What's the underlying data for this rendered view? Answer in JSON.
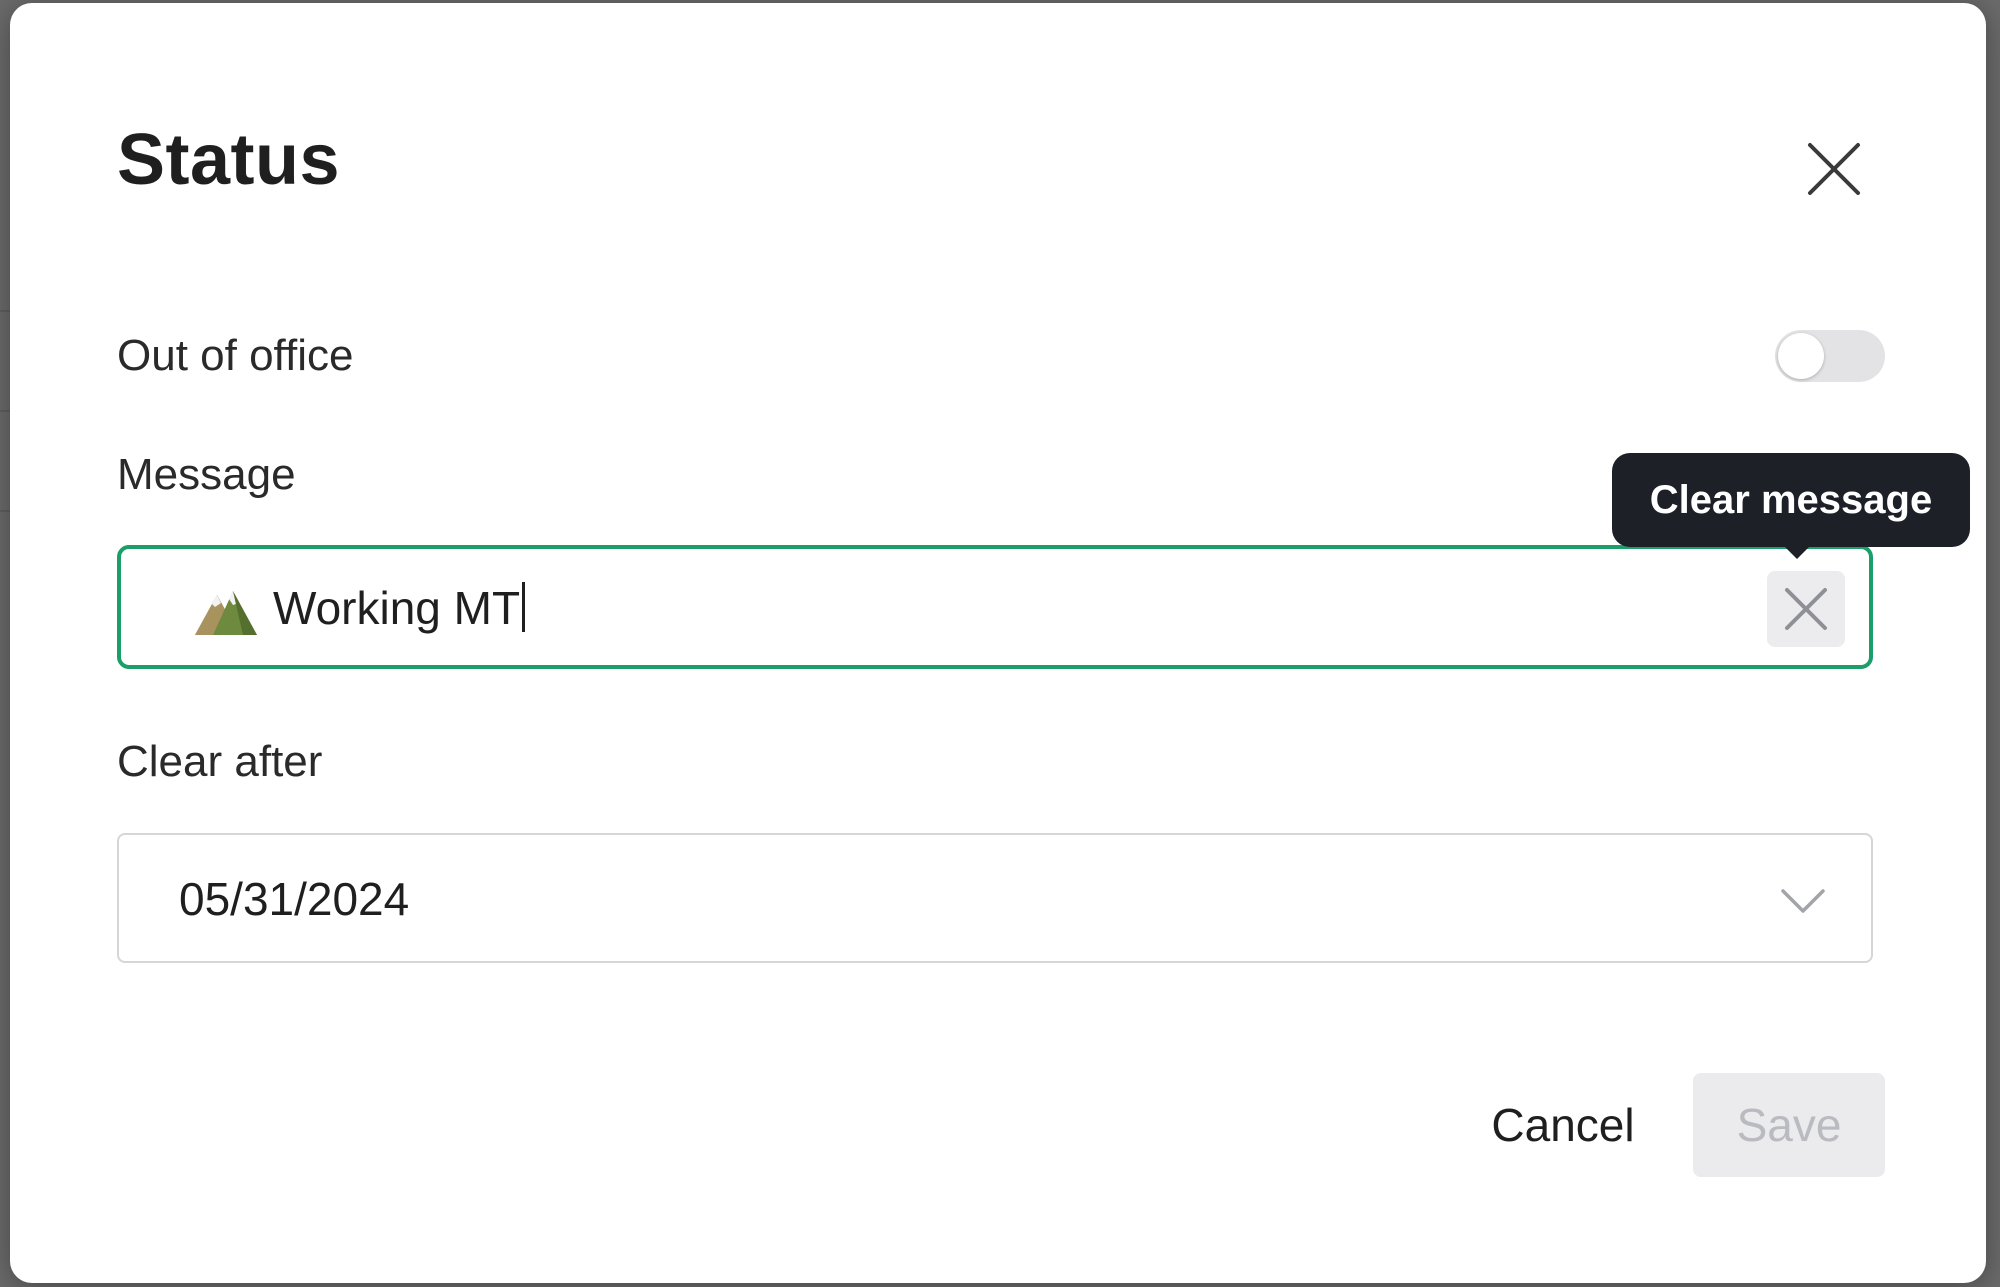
{
  "dialog": {
    "title": "Status",
    "out_of_office": {
      "label": "Out of office",
      "enabled": false
    },
    "message": {
      "label": "Message",
      "emoji": "mountain-emoji",
      "value": "Working MT",
      "clear_tooltip": "Clear message"
    },
    "clear_after": {
      "label": "Clear after",
      "value": "05/31/2024"
    },
    "buttons": {
      "cancel": "Cancel",
      "save": "Save"
    }
  },
  "colors": {
    "accent": "#1a9e6a",
    "tooltip_bg": "#1d2027",
    "disabled_text": "#b9bbc1"
  }
}
